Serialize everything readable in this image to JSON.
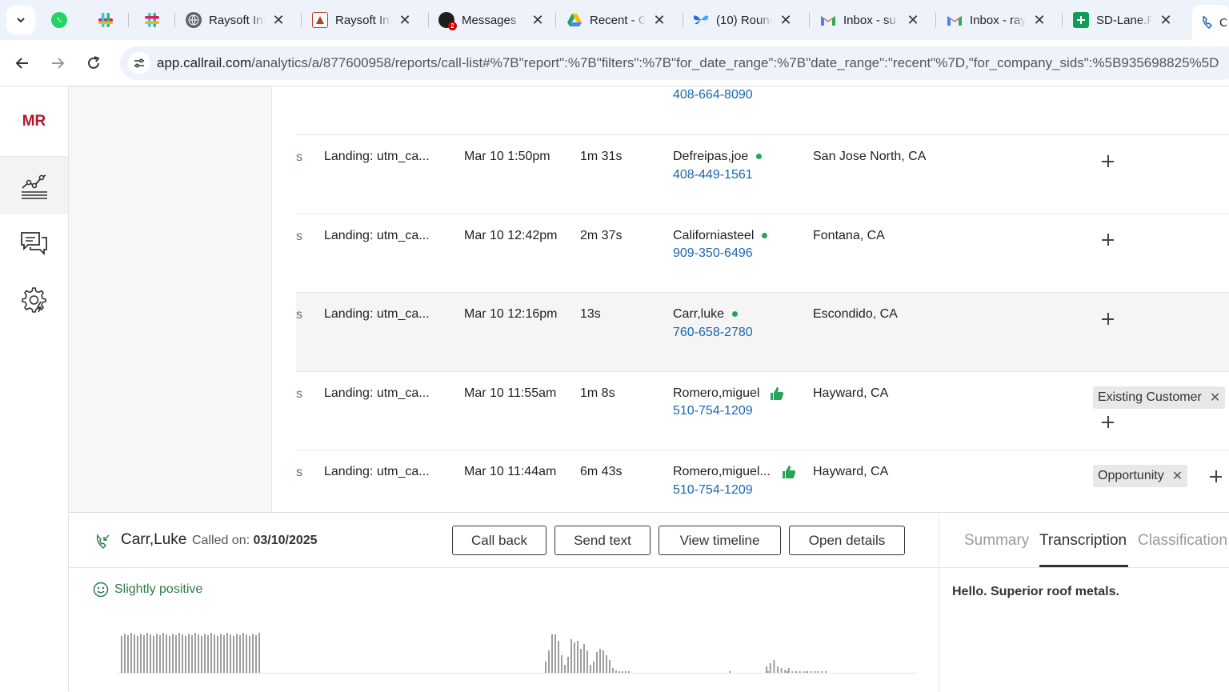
{
  "browser": {
    "tabs": [
      {
        "title": "",
        "icon": "whatsapp-icon",
        "color": "#25d366"
      },
      {
        "title": "",
        "icon": "slack-icon",
        "color": "#e01e5a"
      },
      {
        "title": "",
        "icon": "slack-icon",
        "color": "#36c5f0"
      },
      {
        "title": "Raysoft Inf",
        "icon": "globe-icon",
        "color": "#5f6368"
      },
      {
        "title": "Raysoft Inf",
        "icon": "raysoft-icon",
        "color": "#c0392b"
      },
      {
        "title": "Messages",
        "icon": "messages-icon",
        "color": "#c00",
        "badge": "2"
      },
      {
        "title": "Recent - G",
        "icon": "google-drive-icon",
        "color": "#1fa463"
      },
      {
        "title": "(10) Round",
        "icon": "butterfly-icon",
        "color": "#1a73e8"
      },
      {
        "title": "Inbox - su",
        "icon": "gmail-icon",
        "color": "#ea4335"
      },
      {
        "title": "Inbox - ray",
        "icon": "gmail-icon",
        "color": "#ea4335"
      },
      {
        "title": "SD-Lane.R",
        "icon": "sheets-icon",
        "color": "#0f9d58"
      },
      {
        "title": "C",
        "icon": "callrail-icon",
        "color": "#1a66b0"
      }
    ],
    "url_domain": "app.callrail.com",
    "url_path": "/analytics/a/877600958/reports/call-list#%7B\"report\":%7B\"filters\":%7B\"for_date_range\":%7B\"date_range\":\"recent\"%7D,\"for_company_sids\":%5B935698825%5D"
  },
  "nav": {
    "logo": "MR",
    "items": [
      "analytics-icon",
      "conversations-icon",
      "settings-icon"
    ]
  },
  "rows": [
    {
      "source": "",
      "landing": "",
      "date": "",
      "duration": "",
      "name": "",
      "phone": "408-664-8090",
      "indicator": "none",
      "location": "",
      "tags": [],
      "plus": false
    },
    {
      "source": "s",
      "landing": "Landing: utm_ca...",
      "date": "Mar 10 1:50pm",
      "duration": "1m 31s",
      "name": "Defreipas,joe",
      "phone": "408-449-1561",
      "indicator": "dot",
      "location": "San Jose North, CA",
      "tags": [],
      "plus": true
    },
    {
      "source": "s",
      "landing": "Landing: utm_ca...",
      "date": "Mar 10 12:42pm",
      "duration": "2m 37s",
      "name": "Californiasteel",
      "phone": "909-350-6496",
      "indicator": "dot",
      "location": "Fontana, CA",
      "tags": [],
      "plus": true
    },
    {
      "source": "s",
      "landing": "Landing: utm_ca...",
      "date": "Mar 10 12:16pm",
      "duration": "13s",
      "name": "Carr,luke",
      "phone": "760-658-2780",
      "indicator": "dot",
      "location": "Escondido, CA",
      "tags": [],
      "plus": true
    },
    {
      "source": "s",
      "landing": "Landing: utm_ca...",
      "date": "Mar 10 11:55am",
      "duration": "1m 8s",
      "name": "Romero,miguel",
      "phone": "510-754-1209",
      "indicator": "thumb",
      "location": "Hayward, CA",
      "tags": [
        "Existing Customer"
      ],
      "plus": true
    },
    {
      "source": "s",
      "landing": "Landing: utm_ca...",
      "date": "Mar 10 11:44am",
      "duration": "6m 43s",
      "name": "Romero,miguel...",
      "phone": "510-754-1209",
      "indicator": "thumb",
      "location": "Hayward, CA",
      "tags": [
        "Opportunity"
      ],
      "plus": true
    }
  ],
  "detail": {
    "caller": "Carr,Luke",
    "called_on_label": "Called on:",
    "called_on_date": "03/10/2025",
    "buttons": {
      "call_back": "Call back",
      "send_text": "Send text",
      "view_timeline": "View timeline",
      "open_details": "Open details"
    },
    "sentiment": "Slightly positive",
    "tabs": {
      "summary": "Summary",
      "transcription": "Transcription",
      "classification": "Classification"
    },
    "active_tab": "Transcription",
    "transcript": "Hello. Superior roof metals."
  },
  "colors": {
    "brand": "#b3172d",
    "link": "#1a66b0",
    "positive": "#27a35a"
  }
}
